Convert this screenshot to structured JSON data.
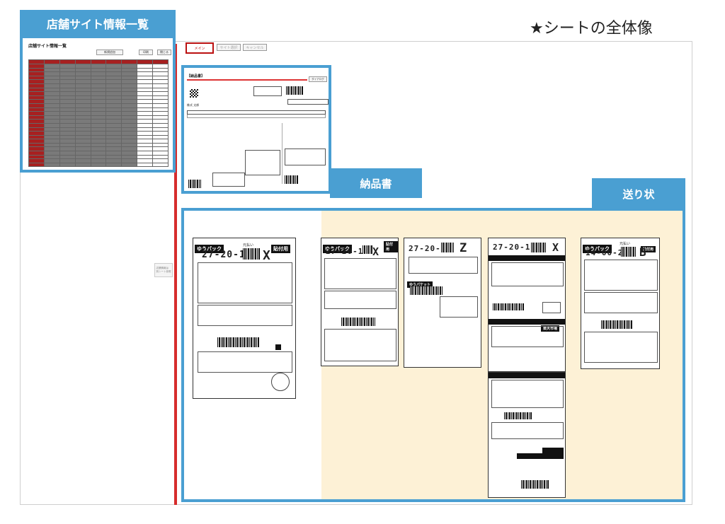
{
  "labels": {
    "store_info": "店舗サイト情報一覧",
    "delivery_note": "納品書",
    "shipping_label": "送り状",
    "caption": "★シートの全体像"
  },
  "mini_sheet": {
    "title": "店舗サイト情報一覧",
    "buttons": [
      "新規追加",
      "印刷",
      "閉じる"
    ]
  },
  "toolbar_buttons": [
    "メイン",
    "サイト選択",
    "キャンセル"
  ],
  "side_note": "店舗情報は\n別シート参照",
  "delivery": {
    "title": "【納品書】",
    "subtitle": "納品書",
    "buttons": [
      "ダイアログ"
    ],
    "shop_heading": "店舗名",
    "customer": "株式 太郎"
  },
  "yuupack": [
    {
      "brand": "ゆうパック",
      "code": "27-20-10",
      "mark": "X",
      "tag": "元払い",
      "stamp": "貼付用"
    },
    {
      "brand": "ゆうパック",
      "code": "27-20-10",
      "mark": "X",
      "tag": "元払い",
      "stamp": "貼付用"
    },
    {
      "brand": "ゆうパケット",
      "code": "27-20-10",
      "mark": "Z",
      "tag": "",
      "stamp": ""
    },
    {
      "brand": "楽天市場",
      "code": "27-20-10",
      "mark": "X",
      "tag": "",
      "stamp": ""
    },
    {
      "brand": "ゆうパック",
      "code": "14-00-23",
      "mark": "B",
      "tag": "元払い",
      "stamp": "貼付用"
    }
  ],
  "colors": {
    "accent": "#4a9fd2",
    "rule": "#d62c2c",
    "highlight": "#fdf1d6"
  }
}
